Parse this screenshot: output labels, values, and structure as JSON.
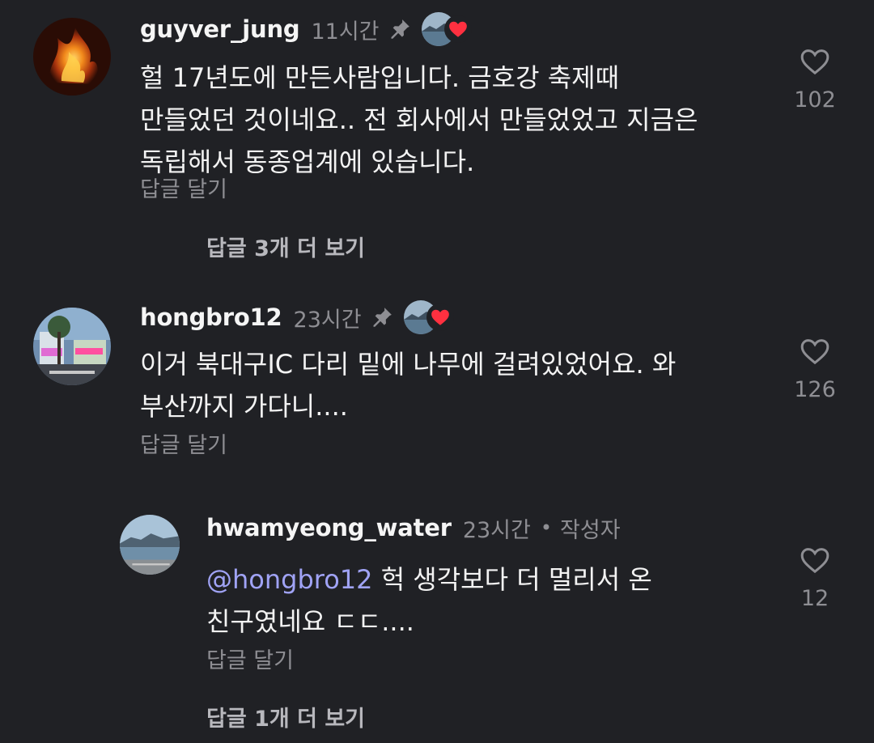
{
  "comments": [
    {
      "username": "guyver_jung",
      "time": "11시간",
      "body_lines": [
        "헐 17년도에 만든사람입니다. 금호강 축제때",
        "만들었던 것이네요.. 전 회사에서 만들었었고 지금은",
        "독립해서 동종업계에 있습니다."
      ],
      "likes": "102",
      "reply_label": "답글 달기",
      "more_replies": "답글 3개 더 보기"
    },
    {
      "username": "hongbro12",
      "time": "23시간",
      "body_lines": [
        "이거 북대구IC 다리 밑에 나무에 걸려있었어요. 와",
        "부산까지 가다니...."
      ],
      "likes": "126",
      "reply_label": "답글 달기"
    },
    {
      "username": "hwamyeong_water",
      "time": "23시간",
      "dot": "•",
      "author_badge": "작성자",
      "mention": "@hongbro12",
      "body_line1_rest": " 헉 생각보다 더 멀리서 온",
      "body_line2": "친구였네요 ㄷㄷ....",
      "likes": "12",
      "reply_label": "답글 달기",
      "more_replies": "답글 1개 더 보기"
    }
  ],
  "icons": {
    "pin": "pin-icon",
    "heart_outline": "heart-outline-icon",
    "heart_filled": "heart-filled-icon"
  },
  "colors": {
    "background": "#202125",
    "mention": "#a0a3f5",
    "heart_red": "#ff3040",
    "muted": "#8e8e93"
  }
}
